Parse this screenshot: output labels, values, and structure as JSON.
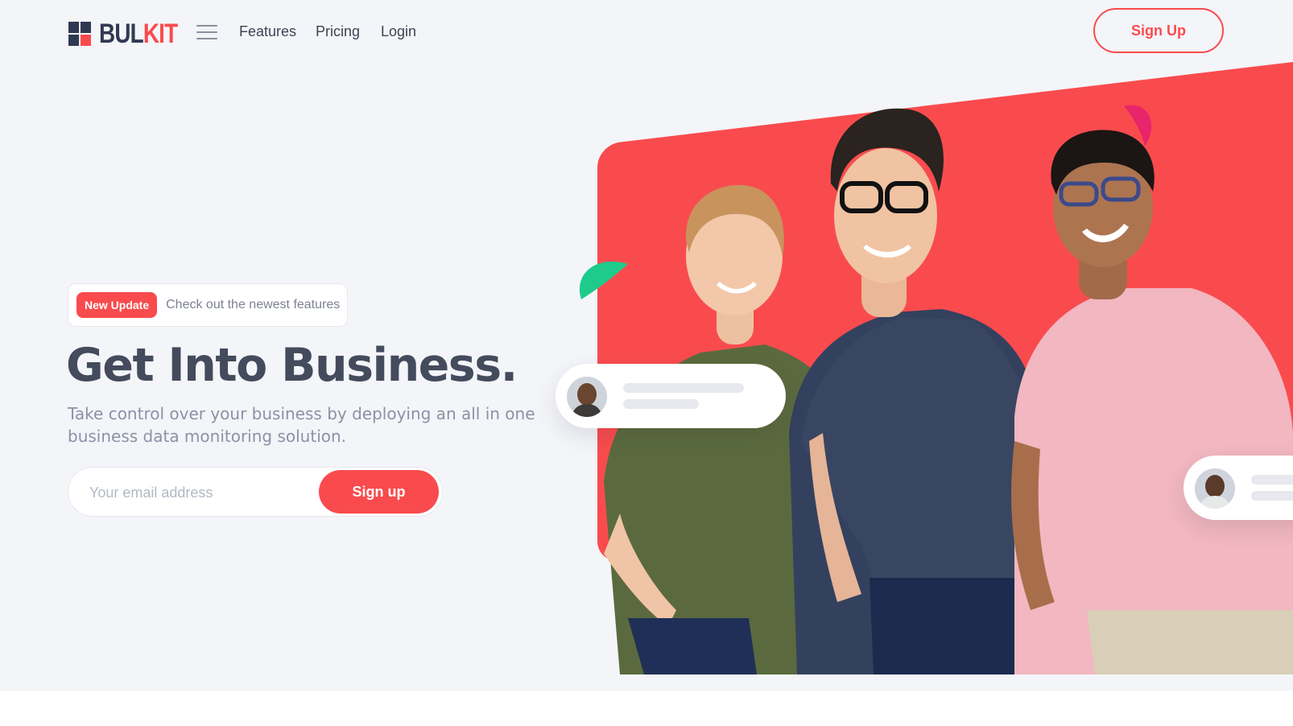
{
  "brand": {
    "name_part1": "BUL",
    "name_part2": "KIT",
    "colors": {
      "primary": "#f94b4e",
      "dark": "#2f3a52",
      "accent_green": "#1ecb8b",
      "accent_pink": "#e8246a"
    }
  },
  "nav": {
    "menu_icon": "hamburger-icon",
    "links": [
      "Features",
      "Pricing",
      "Login"
    ],
    "cta_label": "Sign Up"
  },
  "hero": {
    "update_badge": "New Update",
    "update_text": "Check out the newest features",
    "title": "Get Into Business.",
    "subtitle": "Take control over your business by deploying an all in one business data monitoring solution.",
    "email_placeholder": "Your email address",
    "signup_label": "Sign up"
  }
}
